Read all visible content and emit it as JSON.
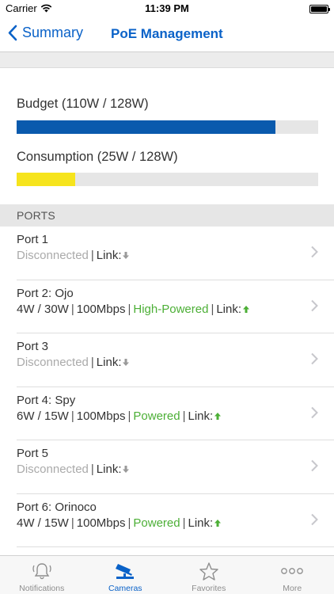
{
  "status_bar": {
    "carrier": "Carrier",
    "time": "11:39 PM"
  },
  "nav": {
    "back_label": "Summary",
    "title": "PoE Management"
  },
  "budget": {
    "label": "Budget (110W / 128W)",
    "fraction": 0.859,
    "color": "#0a5aad"
  },
  "consumption": {
    "label": "Consumption (25W / 128W)",
    "fraction": 0.195,
    "color": "#f6e41d"
  },
  "colors": {
    "accent": "#0a62c8",
    "powered_green": "#4caf36",
    "muted_gray": "#aaaaaa"
  },
  "ports": {
    "header": "PORTS",
    "items": [
      {
        "title": "Port 1",
        "status": "Disconnected",
        "link_label": "Link:",
        "link": "down"
      },
      {
        "title": "Port 2:  Ojo",
        "usage": "4W / 30W",
        "speed": "100Mbps",
        "power": "High-Powered",
        "link_label": "Link:",
        "link": "up"
      },
      {
        "title": "Port 3",
        "status": "Disconnected",
        "link_label": "Link:",
        "link": "down"
      },
      {
        "title": "Port 4:  Spy",
        "usage": "6W / 15W",
        "speed": "100Mbps",
        "power": "Powered",
        "link_label": "Link:",
        "link": "up"
      },
      {
        "title": "Port 5",
        "status": "Disconnected",
        "link_label": "Link:",
        "link": "down"
      },
      {
        "title": "Port 6:  Orinoco",
        "usage": "4W / 15W",
        "speed": "100Mbps",
        "power": "Powered",
        "link_label": "Link:",
        "link": "up"
      }
    ]
  },
  "tabs": [
    {
      "label": "Notifications",
      "icon": "bell-icon",
      "active": false
    },
    {
      "label": "Cameras",
      "icon": "camera-icon",
      "active": true
    },
    {
      "label": "Favorites",
      "icon": "star-icon",
      "active": false
    },
    {
      "label": "More",
      "icon": "more-icon",
      "active": false
    }
  ]
}
